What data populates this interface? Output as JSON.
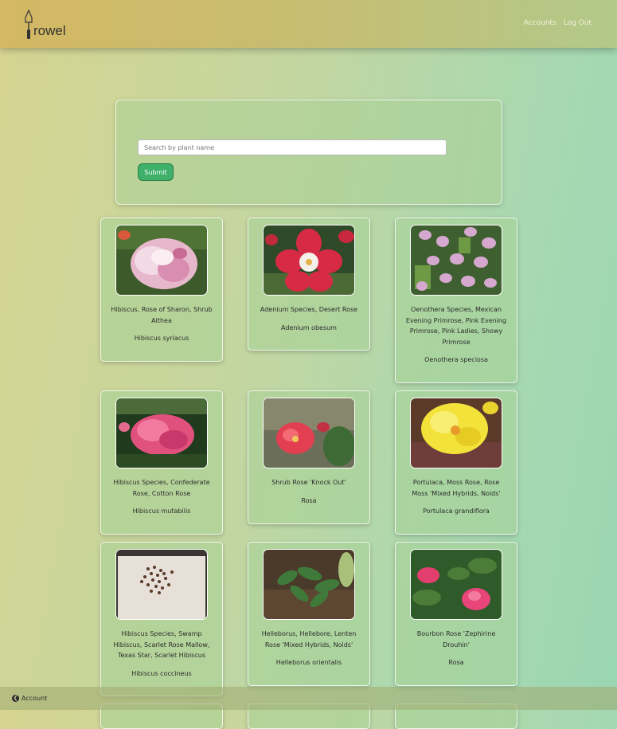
{
  "nav": {
    "logo_text": "rowel",
    "links": [
      "Accounts",
      "Log Out"
    ]
  },
  "search": {
    "placeholder": "Search by plant name",
    "value": "",
    "submit_label": "Submit"
  },
  "plants": [
    {
      "common": "Hibiscus, Rose of Sharon, Shrub Althea",
      "scientific": "Hibiscus syriacus",
      "photo": "pink-white-flower"
    },
    {
      "common": "Adenium Species, Desert Rose",
      "scientific": "Adenium obesum",
      "photo": "red-white-flower"
    },
    {
      "common": "Oenothera Species, Mexican Evening Primrose, Pink Evening Primrose, Pink Ladies, Showy Primrose",
      "scientific": "Oenothera speciosa",
      "photo": "small-pink-flowers"
    },
    {
      "common": "Hibiscus Species, Confederate Rose, Cotton Rose",
      "scientific": "Hibiscus mutabilis",
      "photo": "pink-double-flower"
    },
    {
      "common": "Shrub Rose 'Knock Out'",
      "scientific": "Rosa",
      "photo": "red-rose"
    },
    {
      "common": "Portulaca, Moss Rose, Rose Moss 'Mixed Hybrids, Noids'",
      "scientific": "Portulaca grandiflora",
      "photo": "yellow-flower"
    },
    {
      "common": "Hibiscus Species, Swamp Hibiscus, Scarlet Rose Mallow, Texas Star, Scarlet Hibiscus",
      "scientific": "Hibiscus coccineus",
      "photo": "seeds-on-paper"
    },
    {
      "common": "Helleborus, Hellebore, Lenten Rose 'Mixed Hybrids, Noids'",
      "scientific": "Helleborus orientalis",
      "photo": "green-leaves"
    },
    {
      "common": "Bourbon Rose 'Zephirine Drouhin'",
      "scientific": "Rosa",
      "photo": "pink-roses"
    }
  ],
  "footer": {
    "account_label": "Account"
  }
}
